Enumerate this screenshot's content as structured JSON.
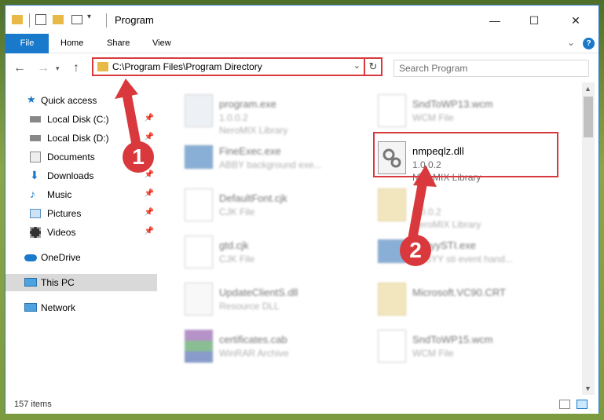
{
  "window": {
    "title": "Program",
    "minimize": "—",
    "maximize": "☐",
    "close": "✕"
  },
  "ribbon": {
    "tabs": [
      "File",
      "Home",
      "Share",
      "View"
    ],
    "help": "?",
    "chevron": "⌄"
  },
  "address": {
    "path": "C:\\Program Files\\Program Directory",
    "search_placeholder": "Search Program"
  },
  "sidebar": {
    "items": [
      {
        "label": "Quick access",
        "icon": "star-icon"
      },
      {
        "label": "Local Disk (C:)",
        "icon": "drive-icon",
        "pinned": true
      },
      {
        "label": "Local Disk (D:)",
        "icon": "drive-icon",
        "pinned": true
      },
      {
        "label": "Documents",
        "icon": "documents-icon",
        "pinned": true
      },
      {
        "label": "Downloads",
        "icon": "downloads-icon",
        "pinned": true
      },
      {
        "label": "Music",
        "icon": "music-icon",
        "pinned": true
      },
      {
        "label": "Pictures",
        "icon": "pictures-icon",
        "pinned": true
      },
      {
        "label": "Videos",
        "icon": "videos-icon",
        "pinned": true
      },
      {
        "label": "OneDrive",
        "icon": "cloud-icon"
      },
      {
        "label": "This PC",
        "icon": "computer-icon"
      },
      {
        "label": "Network",
        "icon": "network-icon"
      }
    ]
  },
  "files": [
    {
      "name": "program.exe",
      "line2": "1.0.0.2",
      "line3": "NeroMIX Library"
    },
    {
      "name": "SndToWP13.wcm",
      "line2": "WCM File",
      "line3": ""
    },
    {
      "name": "FineExec.exe",
      "line2": "ABBY background exe...",
      "line3": ""
    },
    {
      "name": "nmpeqlz.dll",
      "line2": "1.0.0.2",
      "line3": "NeroMIX Library"
    },
    {
      "name": "DefaultFont.cjk",
      "line2": "CJK File",
      "line3": ""
    },
    {
      "name": "",
      "line2": "1.0.0.2",
      "line3": "NeroMIX Library"
    },
    {
      "name": "gtd.cjk",
      "line2": "CJK File",
      "line3": ""
    },
    {
      "name": "AbbyySTI.exe",
      "line2": "ABBYY sti event hand...",
      "line3": ""
    },
    {
      "name": "UpdateClientS.dll",
      "line2": "Resource DLL",
      "line3": ""
    },
    {
      "name": "Microsoft.VC90.CRT",
      "line2": "",
      "line3": ""
    },
    {
      "name": "certificates.cab",
      "line2": "WinRAR Archive",
      "line3": ""
    },
    {
      "name": "SndToWP15.wcm",
      "line2": "WCM File",
      "line3": ""
    }
  ],
  "status": {
    "count": "157 items"
  },
  "callouts": [
    "1",
    "2"
  ],
  "colors": {
    "accent": "#1979ca",
    "highlight": "#d9393c",
    "folder": "#e8b947"
  }
}
